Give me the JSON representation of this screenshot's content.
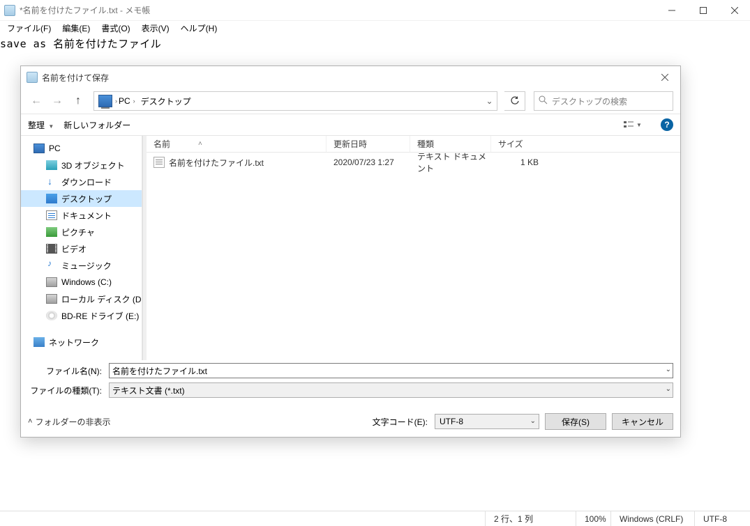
{
  "notepad": {
    "title": "*名前を付けたファイル.txt - メモ帳",
    "menu": {
      "file": "ファイル(F)",
      "edit": "編集(E)",
      "format": "書式(O)",
      "view": "表示(V)",
      "help": "ヘルプ(H)"
    },
    "content": "save as 名前を付けたファイル"
  },
  "dialog": {
    "title": "名前を付けて保存",
    "breadcrumb": {
      "pc": "PC",
      "desktop": "デスクトップ"
    },
    "search_placeholder": "デスクトップの検索",
    "toolbar": {
      "organize": "整理",
      "new_folder": "新しいフォルダー"
    },
    "tree": {
      "pc": "PC",
      "obj3d": "3D オブジェクト",
      "downloads": "ダウンロード",
      "desktop": "デスクトップ",
      "documents": "ドキュメント",
      "pictures": "ピクチャ",
      "videos": "ビデオ",
      "music": "ミュージック",
      "windows_c": "Windows (C:)",
      "local_d": "ローカル ディスク (D:)",
      "bdre_e": "BD-RE ドライブ (E:)",
      "network": "ネットワーク"
    },
    "columns": {
      "name": "名前",
      "date": "更新日時",
      "type": "種類",
      "size": "サイズ"
    },
    "files": [
      {
        "name": "名前を付けたファイル.txt",
        "date": "2020/07/23 1:27",
        "type": "テキスト ドキュメント",
        "size": "1 KB"
      }
    ],
    "filename_label": "ファイル名(N):",
    "filename_value": "名前を付けたファイル.txt",
    "filetype_label": "ファイルの種類(T):",
    "filetype_value": "テキスト文書 (*.txt)",
    "hide_folders": "フォルダーの非表示",
    "encoding_label": "文字コード(E):",
    "encoding_value": "UTF-8",
    "save_button": "保存(S)",
    "cancel_button": "キャンセル"
  },
  "status": {
    "pos": "2 行、1 列",
    "zoom": "100%",
    "eol": "Windows (CRLF)",
    "enc": "UTF-8"
  }
}
